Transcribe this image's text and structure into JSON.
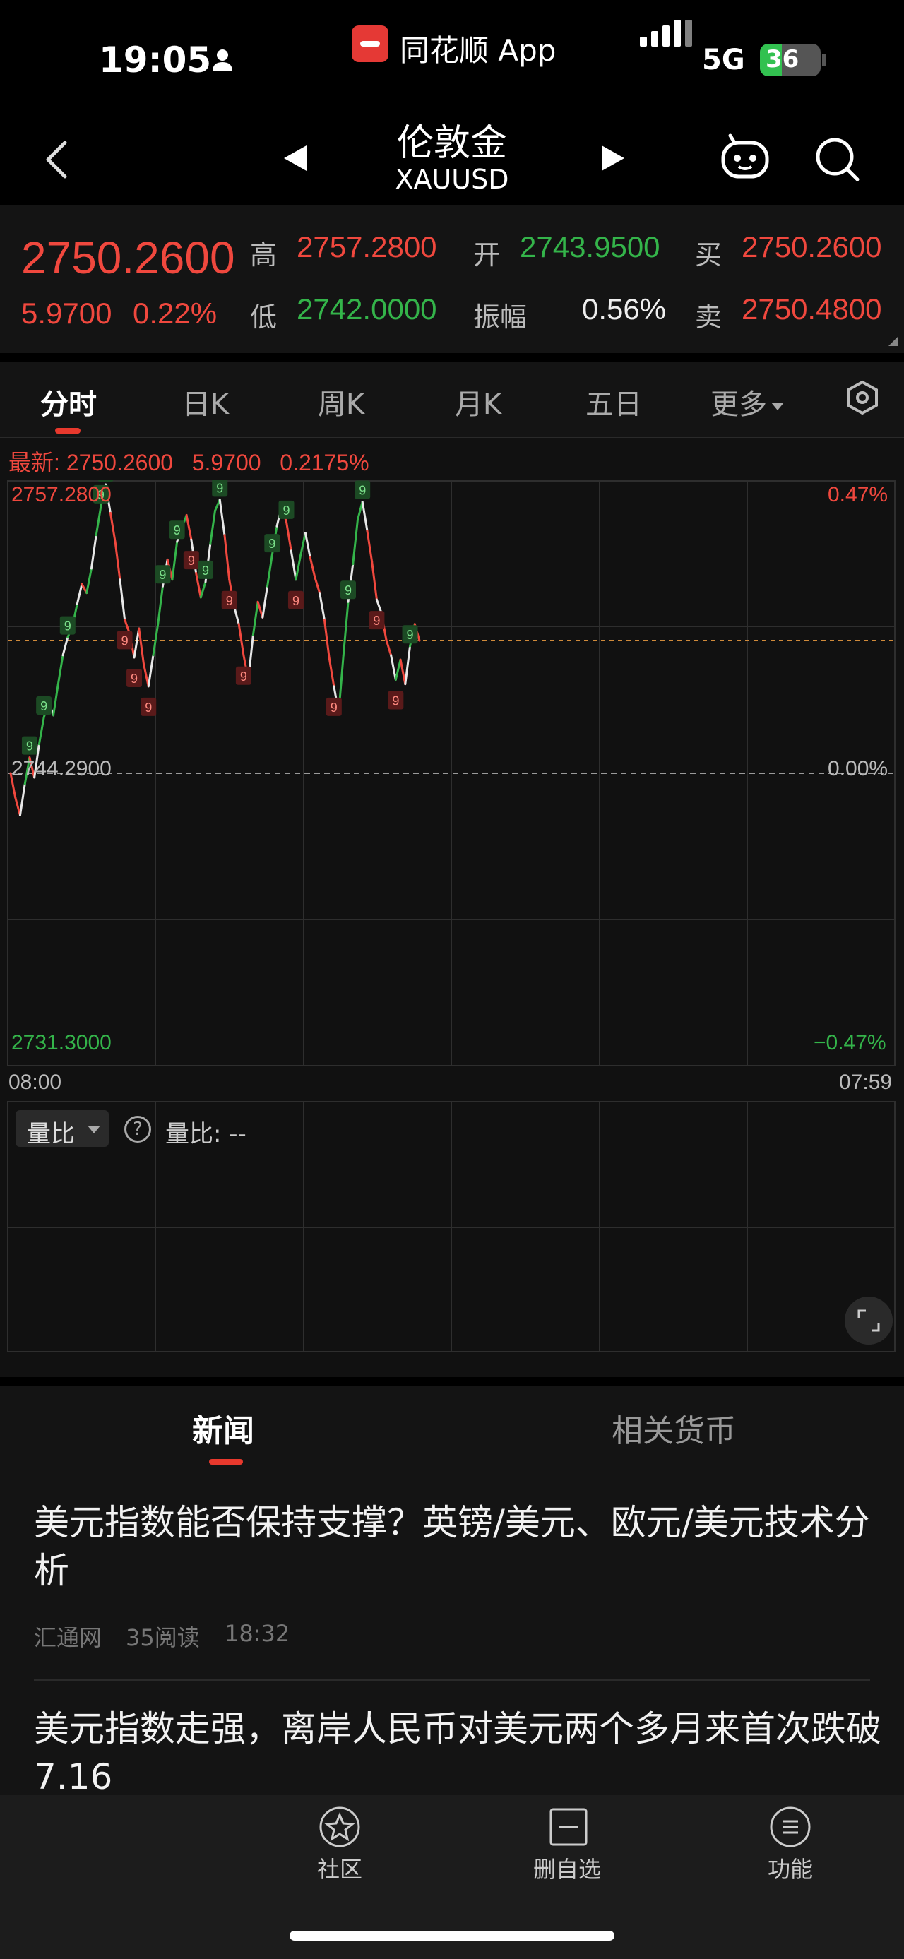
{
  "status_bar": {
    "time": "19:05",
    "network": "5G",
    "battery": "36"
  },
  "app_banner": {
    "name": "同花顺 App"
  },
  "header": {
    "title": "伦敦金",
    "symbol": "XAUUSD"
  },
  "quote": {
    "price": "2750.2600",
    "change": "5.9700",
    "change_pct": "0.22%",
    "high_label": "高",
    "high": "2757.2800",
    "open_label": "开",
    "open": "2743.9500",
    "buy_label": "买",
    "buy": "2750.2600",
    "low_label": "低",
    "low": "2742.0000",
    "amp_label": "振幅",
    "amplitude": "0.56%",
    "sell_label": "卖",
    "sell": "2750.4800",
    "colors": {
      "up": "#f0483e",
      "down": "#34b44a"
    }
  },
  "tabs": [
    {
      "label": "分时",
      "active": true
    },
    {
      "label": "日K"
    },
    {
      "label": "周K"
    },
    {
      "label": "月K"
    },
    {
      "label": "五日"
    },
    {
      "label": "更多"
    }
  ],
  "chart": {
    "latest_line": "最新: 2750.2600   5.9700   0.2175%",
    "y_top": "2757.2800",
    "y_mid": "2744.2900",
    "y_bot": "2731.3000",
    "pct_top": "0.47%",
    "pct_mid": "0.00%",
    "pct_bot": "−0.47%",
    "time_start": "08:00",
    "time_end": "07:59"
  },
  "volume": {
    "dropdown": "量比",
    "help": "?",
    "label": "量比: --"
  },
  "news_tabs": {
    "news": "新闻",
    "related": "相关货币"
  },
  "news": [
    {
      "title": "美元指数能否保持支撑？英镑/美元、欧元/美元技术分析",
      "source": "汇通网",
      "reads": "35阅读",
      "time": "18:32"
    },
    {
      "title": "美元指数走强，离岸人民币对美元两个多月来首次跌破7.16"
    }
  ],
  "bottom_bar": [
    {
      "label": "社区",
      "icon": "star-circle-icon"
    },
    {
      "label": "删自选",
      "icon": "minus-square-icon"
    },
    {
      "label": "功能",
      "icon": "menu-circle-icon"
    }
  ],
  "chart_data": {
    "type": "line",
    "ylim": [
      2731.3,
      2757.28
    ],
    "baseline": 2744.29,
    "x_range": [
      "08:00",
      "07:59"
    ],
    "series": [
      {
        "values": [
          2744.29,
          2743.2,
          2742.4,
          2743.8,
          2745.0,
          2744.1,
          2745.6,
          2746.8,
          2747.5,
          2746.9,
          2748.3,
          2749.6,
          2750.4,
          2750.9,
          2751.9,
          2752.8,
          2752.4,
          2753.5,
          2755.0,
          2756.3,
          2757.28,
          2756.0,
          2754.7,
          2753.0,
          2751.2,
          2750.6,
          2749.5,
          2750.8,
          2749.2,
          2748.2,
          2749.6,
          2751.0,
          2752.7,
          2753.9,
          2753.0,
          2754.7,
          2755.3,
          2755.9,
          2754.8,
          2753.3,
          2752.2,
          2752.9,
          2754.6,
          2756.1,
          2756.6,
          2755.0,
          2753.0,
          2751.8,
          2751.0,
          2749.6,
          2748.5,
          2750.5,
          2752.0,
          2751.3,
          2752.7,
          2754.1,
          2755.4,
          2756.3,
          2755.6,
          2754.3,
          2753.0,
          2754.1,
          2755.1,
          2754.0,
          2753.1,
          2752.4,
          2751.2,
          2749.5,
          2748.2,
          2747.0,
          2749.6,
          2752.0,
          2753.7,
          2755.7,
          2756.5,
          2755.2,
          2753.8,
          2752.1,
          2751.5,
          2750.3,
          2749.6,
          2748.5,
          2749.4,
          2748.3,
          2750.0,
          2751.0,
          2750.26
        ]
      }
    ],
    "markers": [
      {
        "i": 4,
        "kind": "up"
      },
      {
        "i": 7,
        "kind": "up"
      },
      {
        "i": 12,
        "kind": "up"
      },
      {
        "i": 19,
        "kind": "up"
      },
      {
        "i": 20,
        "kind": "up"
      },
      {
        "i": 24,
        "kind": "down"
      },
      {
        "i": 26,
        "kind": "down"
      },
      {
        "i": 29,
        "kind": "down"
      },
      {
        "i": 32,
        "kind": "up"
      },
      {
        "i": 35,
        "kind": "up"
      },
      {
        "i": 38,
        "kind": "down"
      },
      {
        "i": 41,
        "kind": "up"
      },
      {
        "i": 44,
        "kind": "up"
      },
      {
        "i": 46,
        "kind": "down"
      },
      {
        "i": 49,
        "kind": "down"
      },
      {
        "i": 55,
        "kind": "up"
      },
      {
        "i": 58,
        "kind": "up"
      },
      {
        "i": 60,
        "kind": "down"
      },
      {
        "i": 68,
        "kind": "down"
      },
      {
        "i": 71,
        "kind": "up"
      },
      {
        "i": 74,
        "kind": "up"
      },
      {
        "i": 77,
        "kind": "down"
      },
      {
        "i": 81,
        "kind": "down"
      },
      {
        "i": 84,
        "kind": "up"
      }
    ],
    "marker_label": "9"
  }
}
